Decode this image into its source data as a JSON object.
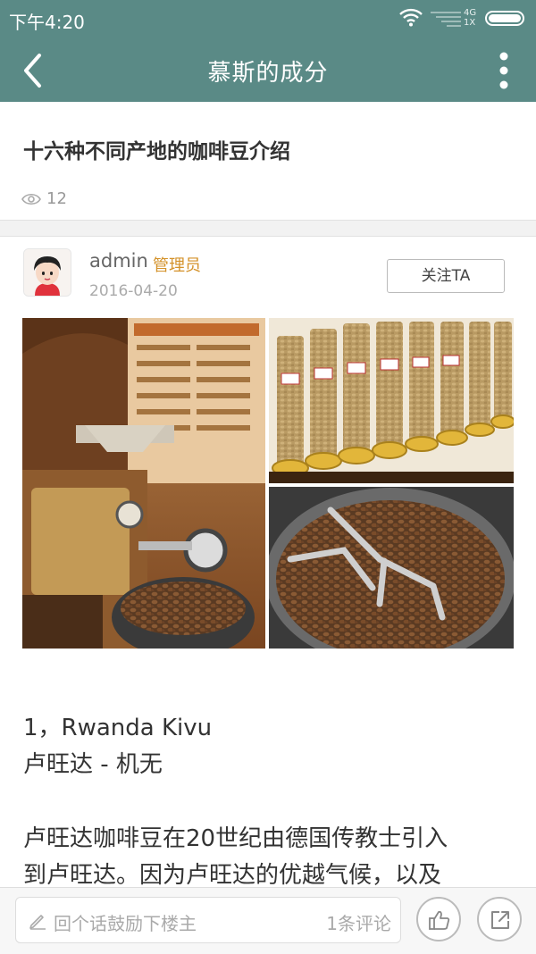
{
  "status_bar": {
    "time": "下午4:20",
    "network": "4G",
    "sim": "1X"
  },
  "app_bar": {
    "title": "慕斯的成分",
    "back_icon": "back-arrow-icon",
    "more_icon": "more-vertical-icon"
  },
  "article": {
    "title": "十六种不同产地的咖啡豆介绍",
    "views": "12"
  },
  "author": {
    "name": "admin",
    "role": "管理员",
    "date": "2016-04-20",
    "follow_label": "关注TA"
  },
  "content": {
    "line1": "1，Rwanda Kivu",
    "line2": "卢旺达 - 机无",
    "line3": "卢旺达咖啡豆在20世纪由德国传教士引入",
    "line4": "到卢旺达。因为卢旺达的优越气候，以及"
  },
  "bottom_bar": {
    "comment_placeholder": "回个话鼓励下楼主",
    "comment_count": "1条评论",
    "like_icon": "thumbs-up-icon",
    "share_icon": "share-icon"
  },
  "colors": {
    "header": "#5a8a86",
    "role_accent": "#d4922a"
  }
}
